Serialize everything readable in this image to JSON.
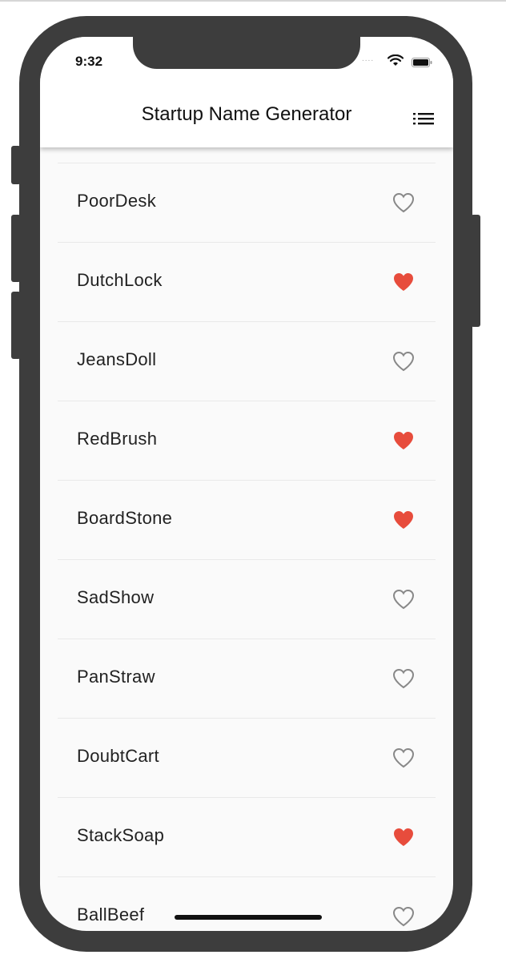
{
  "status_bar": {
    "time": "9:32"
  },
  "app_bar": {
    "title": "Startup Name Generator",
    "action_icon": "list-icon"
  },
  "colors": {
    "saved_heart": "#e74c3c",
    "outline_heart": "#888888",
    "frame": "#3d3d3d"
  },
  "suggestions": [
    {
      "name": "PoorDesk",
      "saved": false
    },
    {
      "name": "DutchLock",
      "saved": true
    },
    {
      "name": "JeansDoll",
      "saved": false
    },
    {
      "name": "RedBrush",
      "saved": true
    },
    {
      "name": "BoardStone",
      "saved": true
    },
    {
      "name": "SadShow",
      "saved": false
    },
    {
      "name": "PanStraw",
      "saved": false
    },
    {
      "name": "DoubtCart",
      "saved": false
    },
    {
      "name": "StackSoap",
      "saved": true
    },
    {
      "name": "BallBeef",
      "saved": false
    }
  ]
}
